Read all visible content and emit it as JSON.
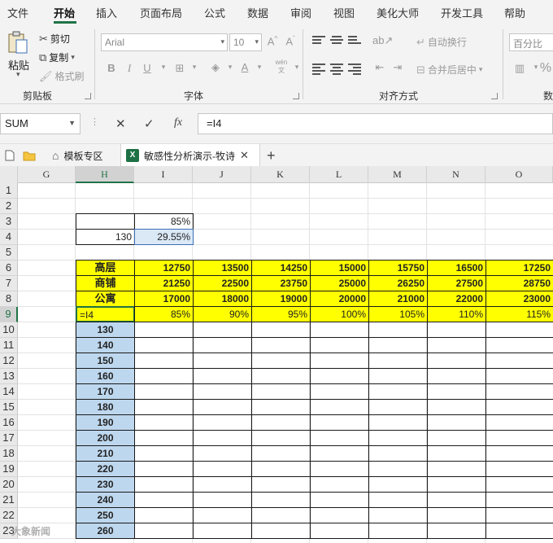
{
  "menu": {
    "items": [
      "文件",
      "开始",
      "插入",
      "页面布局",
      "公式",
      "数据",
      "审阅",
      "视图",
      "美化大师",
      "开发工具",
      "帮助"
    ],
    "active": "开始"
  },
  "ribbon": {
    "clipboard": {
      "label": "剪贴板",
      "paste": "粘贴",
      "cut": "剪切",
      "copy": "复制",
      "format_painter": "格式刷"
    },
    "font": {
      "label": "字体",
      "font_name": "Arial",
      "font_size": "10",
      "bold": "B",
      "italic": "I",
      "underline": "U",
      "phonetic": "wén",
      "phonetic_sub": "文"
    },
    "alignment": {
      "label": "对齐方式",
      "wrap_text": "自动换行",
      "merge_center": "合并后居中"
    },
    "number": {
      "label": "数",
      "format": "百分比",
      "percent": "%"
    }
  },
  "formula_bar": {
    "name_box": "SUM",
    "formula": "=I4",
    "cancel_icon": "close-icon",
    "enter_icon": "check-icon",
    "fx": "fx"
  },
  "tabs": [
    {
      "label": "模板专区",
      "icon": "home-icon"
    },
    {
      "label": "敏感性分析演示-牧诗",
      "icon": "excel-icon",
      "active": true
    }
  ],
  "grid": {
    "columns": [
      "G",
      "H",
      "I",
      "J",
      "K",
      "L",
      "M",
      "N",
      "O"
    ],
    "selected_column": "H",
    "rows": [
      "1",
      "2",
      "3",
      "4",
      "5",
      "6",
      "7",
      "8",
      "9",
      "10",
      "11",
      "12",
      "13",
      "14",
      "15",
      "16",
      "17",
      "18",
      "19",
      "20",
      "21",
      "22",
      "23"
    ],
    "selected_row": "9",
    "cells": {
      "I3": "85%",
      "H4": "130",
      "I4": "29.55%",
      "H6": "高层",
      "H7": "商铺",
      "H8": "公寓",
      "H9": "=I4",
      "row6": [
        "12750",
        "13500",
        "14250",
        "15000",
        "15750",
        "16500",
        "17250"
      ],
      "row7": [
        "21250",
        "22500",
        "23750",
        "25000",
        "26250",
        "27500",
        "28750"
      ],
      "row8": [
        "17000",
        "18000",
        "19000",
        "20000",
        "21000",
        "22000",
        "23000"
      ],
      "row9": [
        "85%",
        "90%",
        "95%",
        "100%",
        "105%",
        "110%",
        "115%"
      ],
      "col_H_values": [
        "130",
        "140",
        "150",
        "160",
        "170",
        "180",
        "190",
        "200",
        "210",
        "220",
        "230",
        "240",
        "250",
        "260"
      ]
    },
    "colors": {
      "highlight": "#ffff00",
      "input_column": "#bdd7ee",
      "accent": "#217346"
    }
  },
  "watermark": "大象新闻"
}
